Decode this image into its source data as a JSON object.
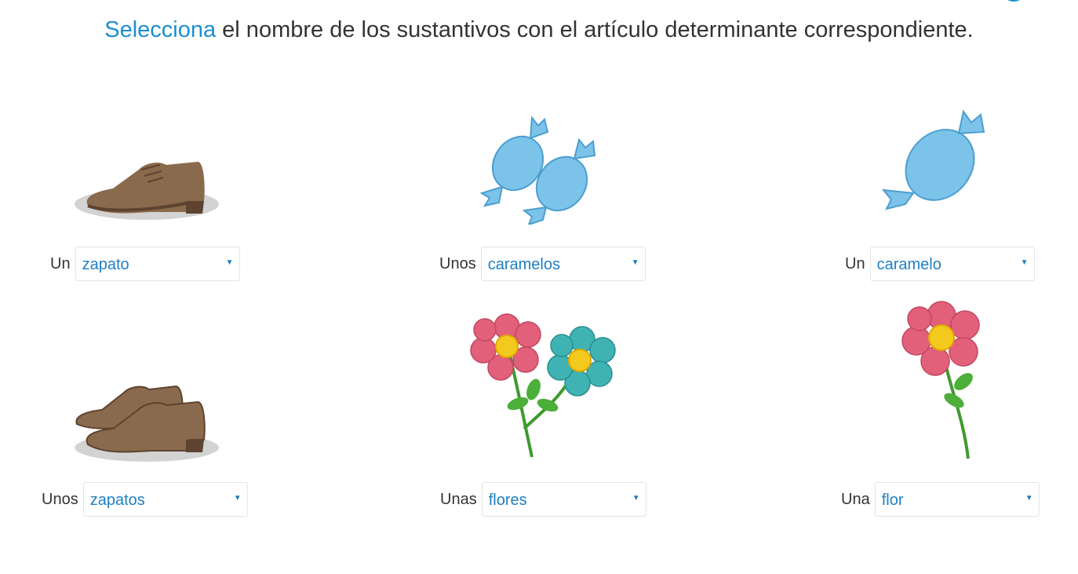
{
  "instruction": {
    "keyword": "Selecciona",
    "text": " el nombre de los sustantivos con el artículo determinante correspondiente."
  },
  "items": [
    {
      "image_icon": "shoe-icon",
      "article": "Un",
      "selected": "zapato"
    },
    {
      "image_icon": "two-candies-icon",
      "article": "Unos",
      "selected": "caramelos"
    },
    {
      "image_icon": "candy-icon",
      "article": "Un",
      "selected": "caramelo"
    },
    {
      "image_icon": "two-shoes-icon",
      "article": "Unos",
      "selected": "zapatos"
    },
    {
      "image_icon": "two-flowers-icon",
      "article": "Unas",
      "selected": "flores"
    },
    {
      "image_icon": "flower-icon",
      "article": "Una",
      "selected": "flor"
    }
  ],
  "dropdown_caret": "▼",
  "colors": {
    "accent": "#1b8fd2",
    "text": "#333333"
  }
}
